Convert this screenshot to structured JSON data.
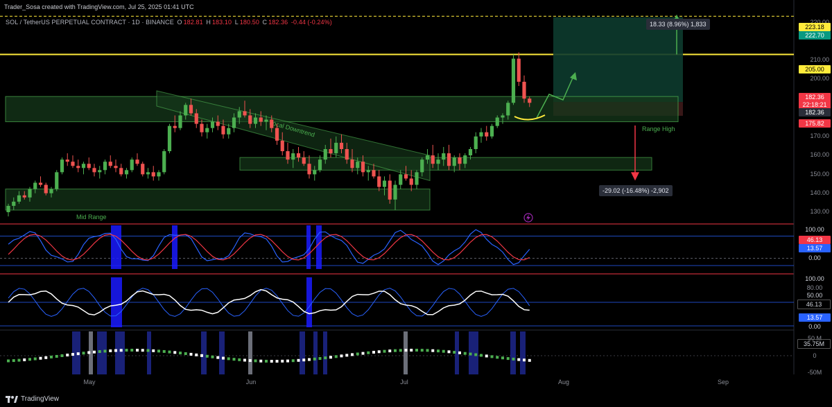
{
  "header": {
    "caption": "Trader_Sosa created with TradingView.com, Jul 25, 2025 01:41 UTC",
    "symbol": "SOL / TetherUS PERPETUAL CONTRACT · 1D · BINANCE",
    "open_label": "O",
    "open": "182.81",
    "high_label": "H",
    "high": "183.10",
    "low_label": "L",
    "low": "180.50",
    "close_label": "C",
    "close": "182.36",
    "change": "-0.44 (-0.24%)"
  },
  "colors": {
    "up": "#26a69a",
    "down": "#ef5350",
    "up_green": "#4caf50",
    "zone": "#1b5e20",
    "yellow": "#ffeb3b",
    "blue": "#2962ff"
  },
  "price_axis": {
    "ticks": [
      "220.00",
      "210.00",
      "200.00",
      "170.00",
      "160.00",
      "150.00",
      "140.00",
      "130.00"
    ],
    "tags": [
      {
        "text": "223.18",
        "bg": "#ffeb3b",
        "fg": "#000"
      },
      {
        "text": "222.70",
        "bg": "#089981",
        "fg": "#fff"
      },
      {
        "text": "205.00",
        "bg": "#ffeb3b",
        "fg": "#000"
      },
      {
        "text": "182.36",
        "bg": "#f23645",
        "fg": "#fff"
      },
      {
        "text": "22:18:21",
        "bg": "#f23645",
        "fg": "#fff"
      },
      {
        "text": "182.36",
        "bg": "#2a2e39",
        "fg": "#fff"
      },
      {
        "text": "175.82",
        "bg": "#f23645",
        "fg": "#fff"
      }
    ]
  },
  "annotations": {
    "long_box": "18.33 (8.96%) 1,833",
    "short_box": "-29.02 (-16.48%) -2,902",
    "range_high": "Range High",
    "mid_range": "Mid Range",
    "local_downtrend": "Local Downtrend"
  },
  "stoch_panel": {
    "tags": [
      {
        "text": "100.00",
        "bg": "#000",
        "fg": "#d1d4dc"
      },
      {
        "text": "46.13",
        "bg": "#f23645",
        "fg": "#fff"
      },
      {
        "text": "13.57",
        "bg": "#2962ff",
        "fg": "#fff"
      },
      {
        "text": "0.00",
        "bg": "#000",
        "fg": "#d1d4dc"
      }
    ]
  },
  "rsi_panel": {
    "tags": [
      {
        "text": "100.00",
        "bg": "#000",
        "fg": "#d1d4dc"
      },
      {
        "text": "80.00",
        "bg": "#000",
        "fg": "#8a8d96"
      },
      {
        "text": "50.00",
        "bg": "#000",
        "fg": "#d1d4dc"
      },
      {
        "text": "46.13",
        "bg": "#000",
        "fg": "#d1d4dc"
      },
      {
        "text": "13.57",
        "bg": "#2962ff",
        "fg": "#fff"
      },
      {
        "text": "0.00",
        "bg": "#000",
        "fg": "#d1d4dc"
      }
    ]
  },
  "volume_panel": {
    "tags": [
      {
        "text": "50 M",
        "bg": "#000",
        "fg": "#8a8d96"
      },
      {
        "text": "35.75M",
        "bg": "#000",
        "fg": "#d1d4dc"
      },
      {
        "text": "0",
        "bg": "#000",
        "fg": "#8a8d96"
      },
      {
        "text": "-50M",
        "bg": "#000",
        "fg": "#8a8d96"
      }
    ]
  },
  "time_axis": {
    "labels": [
      "May",
      "Jun",
      "Jul",
      "Aug",
      "Sep"
    ]
  },
  "brand": "TradingView",
  "chart_data": {
    "type": "candlestick",
    "symbol": "SOL / TetherUS PERPETUAL CONTRACT",
    "interval": "1D",
    "exchange": "BINANCE",
    "x_labels": [
      "May",
      "Jun",
      "Jul",
      "Aug",
      "Sep"
    ],
    "ylim": [
      125,
      225
    ],
    "y_ticks": [
      130,
      140,
      150,
      160,
      170,
      200,
      210,
      220
    ],
    "horizontal_levels": {
      "resistance": 205.0,
      "target": 223.18,
      "long_target": 222.7,
      "stop": 175.82
    },
    "candles_ohlc": [
      [
        130,
        134,
        128,
        133
      ],
      [
        133,
        137,
        131,
        135
      ],
      [
        135,
        140,
        134,
        138
      ],
      [
        138,
        140,
        136,
        137
      ],
      [
        137,
        142,
        135,
        141
      ],
      [
        141,
        145,
        139,
        144
      ],
      [
        144,
        147,
        142,
        143
      ],
      [
        143,
        144,
        138,
        139
      ],
      [
        139,
        142,
        137,
        141
      ],
      [
        141,
        150,
        140,
        149
      ],
      [
        149,
        156,
        148,
        155
      ],
      [
        155,
        158,
        152,
        154
      ],
      [
        154,
        157,
        151,
        152
      ],
      [
        152,
        155,
        149,
        151
      ],
      [
        151,
        154,
        148,
        153
      ],
      [
        153,
        156,
        150,
        151
      ],
      [
        151,
        153,
        147,
        149
      ],
      [
        149,
        152,
        146,
        150
      ],
      [
        150,
        155,
        148,
        154
      ],
      [
        154,
        157,
        151,
        152
      ],
      [
        152,
        155,
        149,
        151
      ],
      [
        151,
        153,
        147,
        148
      ],
      [
        148,
        151,
        146,
        150
      ],
      [
        150,
        156,
        149,
        155
      ],
      [
        155,
        158,
        152,
        153
      ],
      [
        153,
        154,
        147,
        148
      ],
      [
        148,
        151,
        146,
        149
      ],
      [
        149,
        152,
        145,
        147
      ],
      [
        147,
        150,
        145,
        149
      ],
      [
        149,
        160,
        148,
        159
      ],
      [
        159,
        172,
        158,
        171
      ],
      [
        171,
        176,
        168,
        170
      ],
      [
        170,
        178,
        169,
        176
      ],
      [
        176,
        182,
        174,
        181
      ],
      [
        181,
        184,
        176,
        177
      ],
      [
        177,
        179,
        170,
        172
      ],
      [
        172,
        174,
        166,
        168
      ],
      [
        168,
        172,
        165,
        170
      ],
      [
        170,
        175,
        168,
        173
      ],
      [
        173,
        176,
        169,
        171
      ],
      [
        171,
        174,
        165,
        167
      ],
      [
        167,
        172,
        165,
        170
      ],
      [
        170,
        177,
        168,
        175
      ],
      [
        175,
        180,
        172,
        178
      ],
      [
        178,
        183,
        175,
        176
      ],
      [
        176,
        179,
        170,
        172
      ],
      [
        172,
        177,
        170,
        175
      ],
      [
        175,
        178,
        171,
        173
      ],
      [
        173,
        176,
        169,
        174
      ],
      [
        174,
        176,
        168,
        170
      ],
      [
        170,
        172,
        162,
        164
      ],
      [
        164,
        168,
        157,
        159
      ],
      [
        159,
        163,
        153,
        155
      ],
      [
        155,
        160,
        151,
        158
      ],
      [
        158,
        161,
        154,
        156
      ],
      [
        156,
        159,
        152,
        153
      ],
      [
        153,
        157,
        146,
        148
      ],
      [
        148,
        152,
        145,
        150
      ],
      [
        150,
        157,
        149,
        155
      ],
      [
        155,
        162,
        153,
        160
      ],
      [
        160,
        165,
        156,
        158
      ],
      [
        158,
        166,
        156,
        163
      ],
      [
        163,
        167,
        158,
        160
      ],
      [
        160,
        163,
        153,
        155
      ],
      [
        155,
        160,
        149,
        151
      ],
      [
        151,
        156,
        148,
        154
      ],
      [
        154,
        157,
        147,
        149
      ],
      [
        149,
        152,
        145,
        150
      ],
      [
        150,
        153,
        146,
        147
      ],
      [
        147,
        150,
        140,
        142
      ],
      [
        142,
        147,
        138,
        145
      ],
      [
        145,
        148,
        134,
        136
      ],
      [
        136,
        145,
        131,
        143
      ],
      [
        143,
        150,
        141,
        148
      ],
      [
        148,
        152,
        145,
        146
      ],
      [
        146,
        150,
        140,
        143
      ],
      [
        143,
        150,
        141,
        149
      ],
      [
        149,
        156,
        147,
        155
      ],
      [
        155,
        160,
        153,
        157
      ],
      [
        157,
        162,
        151,
        153
      ],
      [
        153,
        158,
        150,
        155
      ],
      [
        155,
        161,
        152,
        158
      ],
      [
        158,
        162,
        150,
        152
      ],
      [
        152,
        157,
        149,
        156
      ],
      [
        156,
        158,
        150,
        153
      ],
      [
        153,
        158,
        151,
        157
      ],
      [
        157,
        161,
        155,
        160
      ],
      [
        160,
        168,
        158,
        166
      ],
      [
        166,
        170,
        163,
        168
      ],
      [
        168,
        171,
        164,
        166
      ],
      [
        166,
        172,
        165,
        171
      ],
      [
        171,
        176,
        170,
        175
      ],
      [
        175,
        177,
        172,
        176
      ],
      [
        176,
        183,
        174,
        182
      ],
      [
        182,
        205,
        181,
        203
      ],
      [
        203,
        206,
        190,
        192
      ],
      [
        192,
        195,
        182,
        184
      ],
      [
        184,
        185,
        180,
        182
      ]
    ],
    "stoch_rsi": {
      "k_last": 46.13,
      "d_last": 13.57,
      "levels": [
        0,
        100
      ]
    },
    "rsi": {
      "last": 46.13,
      "levels": [
        0,
        50,
        80,
        100
      ]
    },
    "volume_last": "35.75M"
  }
}
